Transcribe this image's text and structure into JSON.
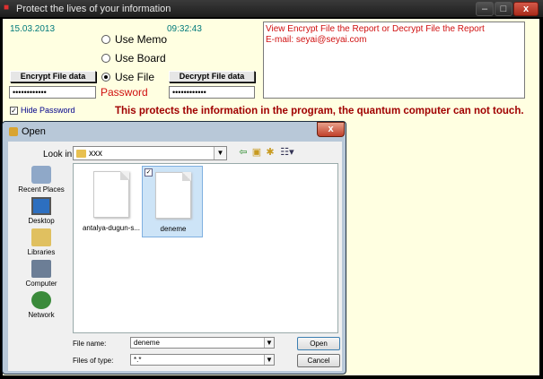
{
  "window": {
    "title": "Protect the lives of your information",
    "controls": {
      "minimize": "–",
      "maximize": "□",
      "close": "x"
    }
  },
  "form": {
    "date": "15.03.2013",
    "time": "09:32:43",
    "radio": {
      "memo": "Use Memo",
      "board": "Use Board",
      "file": "Use File",
      "selected": "file"
    },
    "encrypt_button": "Encrypt  File data",
    "decrypt_button": "Decrypt  File data",
    "password_left": "••••••••••••",
    "password_right": "••••••••••••",
    "password_label": "Password",
    "hide_password_label": "Hide Password",
    "hide_password_checked": true,
    "info_lines": [
      "View  Encrypt File the Report  or Decrypt  File the Report",
      "E-mail: seyai@seyai.com"
    ],
    "warning": "This protects the information in the program, the quantum computer can not touch."
  },
  "dialog": {
    "title": "Open",
    "close": "x",
    "look_in_label": "Look in:",
    "look_in_value": "xxx",
    "places": [
      "Recent Places",
      "Desktop",
      "Libraries",
      "Computer",
      "Network"
    ],
    "files": [
      {
        "name": "antalya-dugun-s...",
        "selected": false
      },
      {
        "name": "deneme",
        "selected": true
      }
    ],
    "file_name_label": "File name:",
    "file_name_value": "deneme",
    "files_of_type_label": "Files of type:",
    "files_of_type_value": "*.*",
    "open_button": "Open",
    "cancel_button": "Cancel"
  },
  "colors": {
    "form_bg": "#ffffe1",
    "accent_red": "#d01010",
    "warning_red": "#a00000",
    "teal": "#007a7a"
  }
}
